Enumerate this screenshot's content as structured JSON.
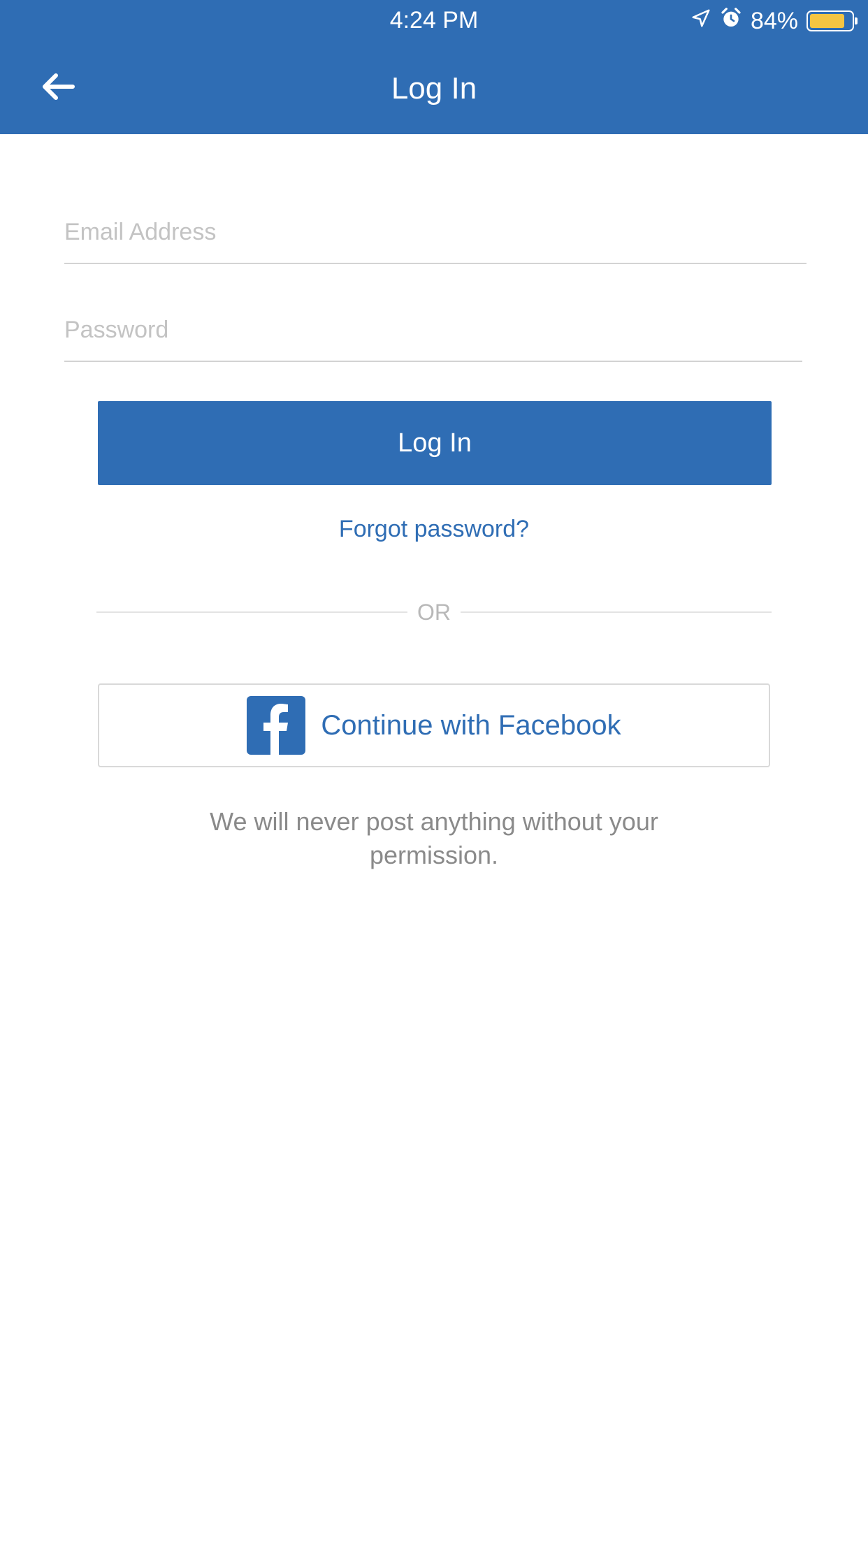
{
  "status_bar": {
    "time": "4:24 PM",
    "battery": "84%",
    "battery_level": 0.84,
    "icons": [
      "location-arrow-icon",
      "alarm-clock-icon",
      "battery-icon"
    ]
  },
  "header": {
    "title": "Log In",
    "back_icon": "arrow-left-icon"
  },
  "form": {
    "email_placeholder": "Email Address",
    "email_value": "",
    "password_placeholder": "Password",
    "password_value": "",
    "login_label": "Log In",
    "forgot_label": "Forgot password?"
  },
  "separator": {
    "label": "OR"
  },
  "facebook": {
    "label": "Continue with Facebook",
    "icon": "facebook-logo-icon"
  },
  "disclaimer": "We will never post anything without your permission.",
  "colors": {
    "brand_blue": "#2f6db4",
    "battery_yellow": "#f5c542",
    "placeholder_gray": "#c3c3c3",
    "disclaimer_gray": "#8a8a8a"
  }
}
